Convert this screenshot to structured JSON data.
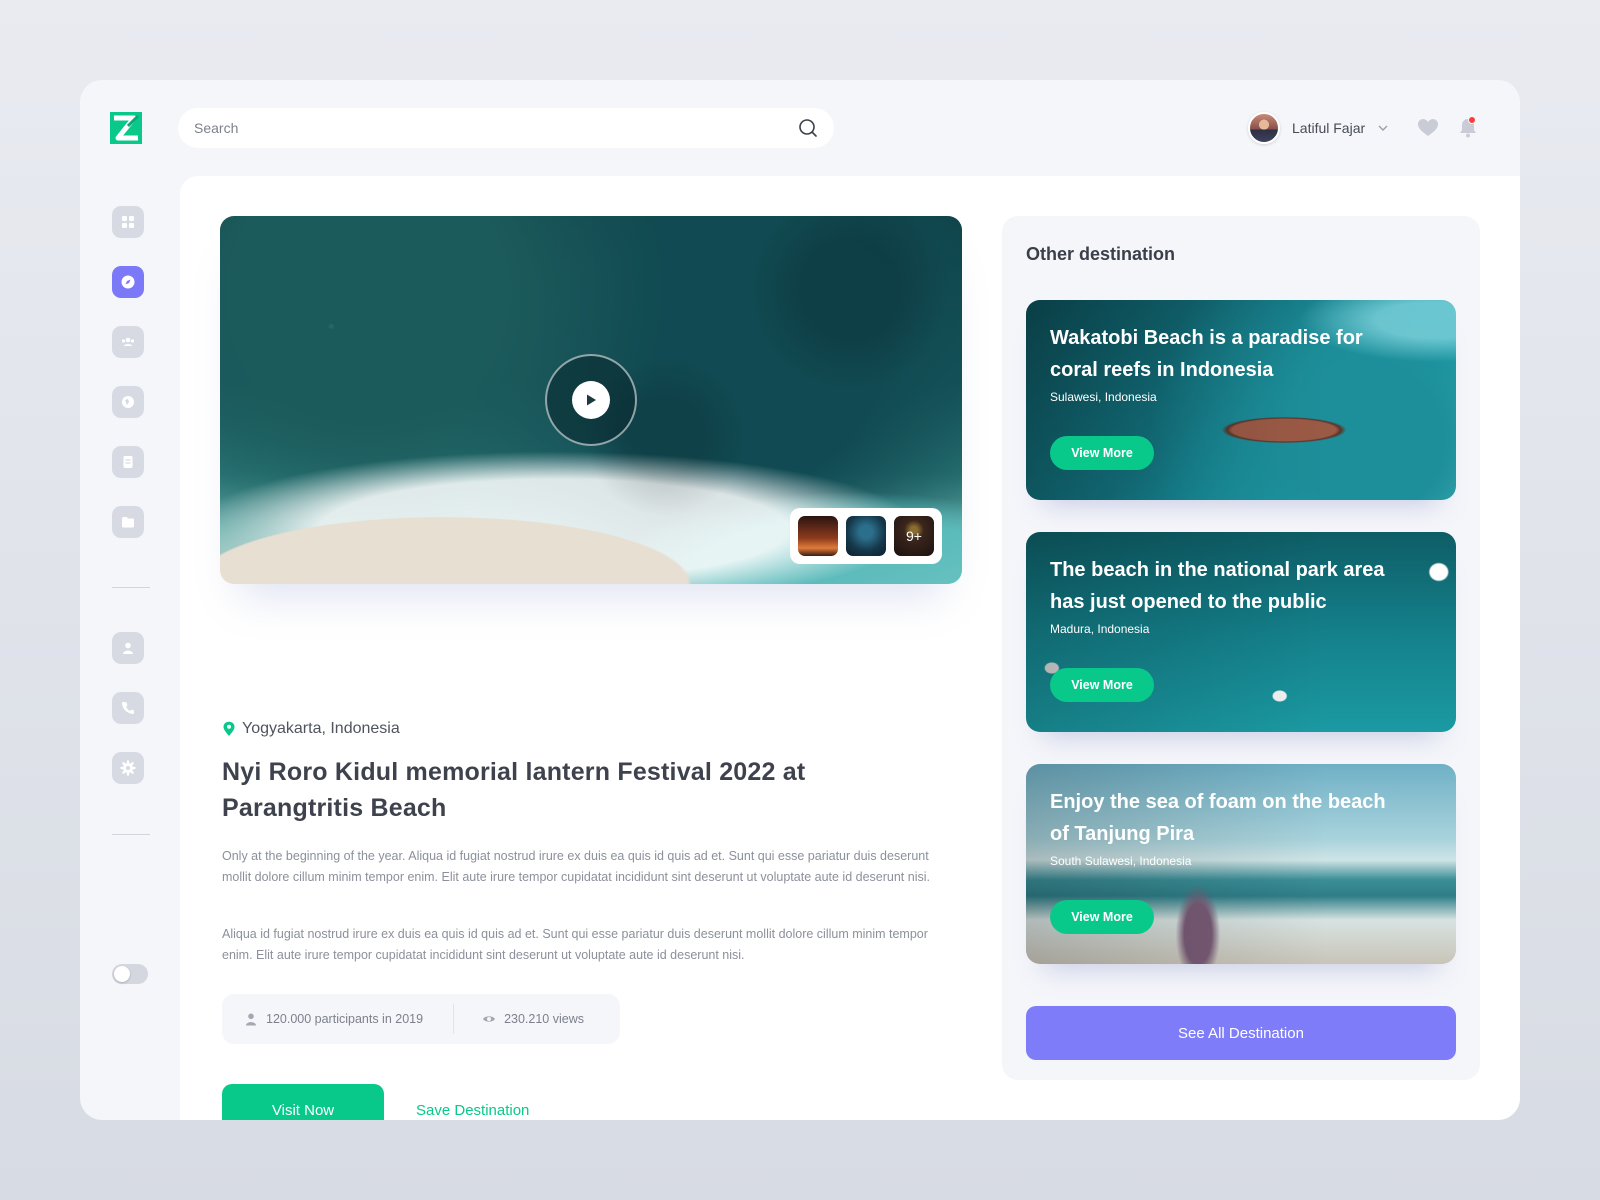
{
  "header": {
    "search": {
      "placeholder": "Search",
      "value": ""
    },
    "user": {
      "name": "Latiful Fajar"
    },
    "icons": [
      "logo-icon",
      "search-icon",
      "chevron-down-icon",
      "heart-icon",
      "bell-icon"
    ]
  },
  "sidebar": {
    "items": [
      {
        "name": "dashboard",
        "icon": "grid-icon",
        "active": false
      },
      {
        "name": "explore",
        "icon": "compass-icon",
        "active": true
      },
      {
        "name": "community",
        "icon": "users-icon",
        "active": false
      },
      {
        "name": "discover",
        "icon": "globe-icon",
        "active": false
      },
      {
        "name": "documents",
        "icon": "document-icon",
        "active": false
      },
      {
        "name": "folders",
        "icon": "folder-icon",
        "active": false
      },
      {
        "name": "profile",
        "icon": "user-icon",
        "active": false
      },
      {
        "name": "calls",
        "icon": "phone-icon",
        "active": false
      },
      {
        "name": "settings",
        "icon": "gear-icon",
        "active": false
      }
    ],
    "dark_mode_toggle": {
      "on": false
    }
  },
  "hero": {
    "gallery_more": "9+",
    "location": "Yogyakarta, Indonesia",
    "title": "Nyi Roro Kidul memorial lantern Festival 2022 at Parangtritis Beach",
    "paragraphs": [
      "Only at the beginning of the year. Aliqua id fugiat nostrud irure ex duis ea quis id quis ad et. Sunt qui esse pariatur duis deserunt mollit dolore cillum minim tempor enim. Elit aute irure tempor cupidatat incididunt sint deserunt ut voluptate aute id deserunt nisi.",
      "Aliqua id fugiat nostrud irure ex duis ea quis id quis ad et. Sunt qui esse pariatur duis deserunt mollit dolore cillum minim tempor enim. Elit aute irure tempor cupidatat incididunt sint deserunt ut voluptate aute id deserunt nisi."
    ],
    "stats": {
      "participants": "120.000 participants in 2019",
      "views": "230.210 views"
    },
    "visit_label": "Visit Now",
    "save_label": "Save Destination"
  },
  "other": {
    "title": "Other destination",
    "cards": [
      {
        "title": "Wakatobi Beach is a paradise for coral reefs in Indonesia",
        "location": "Sulawesi, Indonesia",
        "button": "View More"
      },
      {
        "title": "The beach in the national park area has just opened to the public",
        "location": "Madura, Indonesia",
        "button": "View More"
      },
      {
        "title": "Enjoy the sea of foam on the beach of Tanjung Pira",
        "location": "South Sulawesi, Indonesia",
        "button": "View More"
      }
    ],
    "see_all": "See All Destination"
  },
  "colors": {
    "accent_green": "#09c98a",
    "accent_purple": "#7f7cf9",
    "notification_red": "#ff3b3b"
  }
}
